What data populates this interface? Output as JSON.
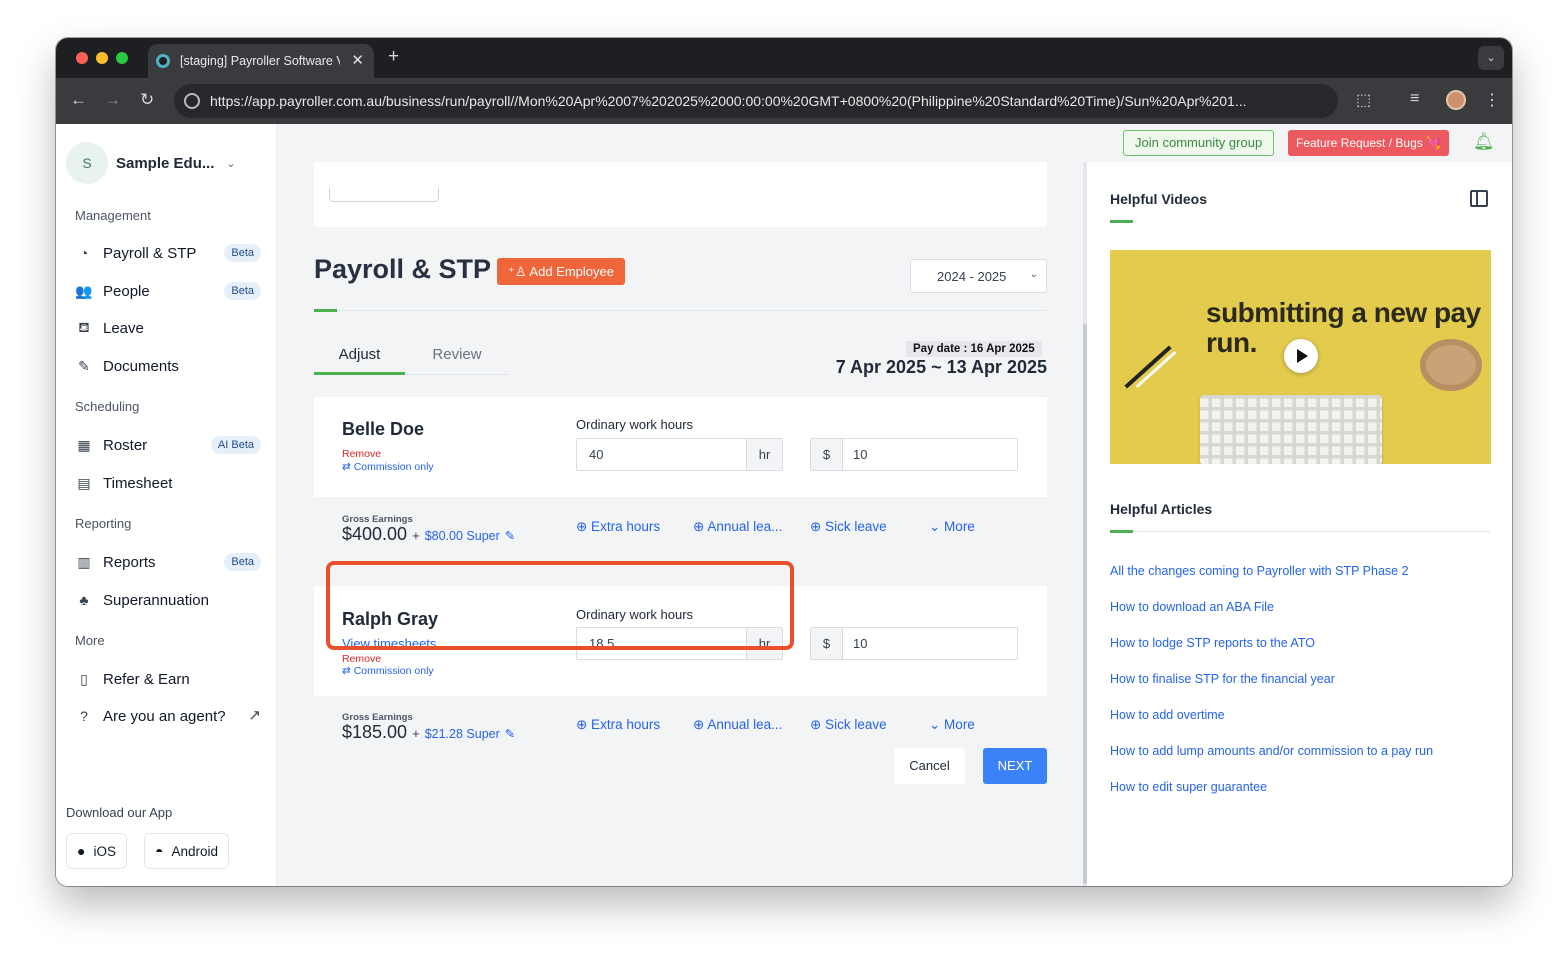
{
  "browser": {
    "tab_title": "[staging] Payroller Software V",
    "url": "https://app.payroller.com.au/business/run/payroll//Mon%20Apr%2007%202025%2000:00:00%20GMT+0800%20(Philippine%20Standard%20Time)/Sun%20Apr%201..."
  },
  "sidebar": {
    "org_initial": "S",
    "org_name": "Sample Edu...",
    "sections": {
      "management": "Management",
      "scheduling": "Scheduling",
      "reporting": "Reporting",
      "more": "More"
    },
    "items": [
      {
        "label": "Payroll & STP",
        "badge": "Beta",
        "icon": "payroll-icon"
      },
      {
        "label": "People",
        "badge": "Beta",
        "icon": "people-icon"
      },
      {
        "label": "Leave",
        "badge": "",
        "icon": "leave-icon"
      },
      {
        "label": "Documents",
        "badge": "",
        "icon": "documents-icon"
      },
      {
        "label": "Roster",
        "badge": "AI Beta",
        "icon": "calendar-icon"
      },
      {
        "label": "Timesheet",
        "badge": "",
        "icon": "timesheet-icon"
      },
      {
        "label": "Reports",
        "badge": "Beta",
        "icon": "reports-icon"
      },
      {
        "label": "Superannuation",
        "badge": "",
        "icon": "piggy-bank-icon"
      },
      {
        "label": "Refer & Earn",
        "badge": "",
        "icon": "refer-icon"
      },
      {
        "label": "Are you an agent?",
        "badge": "",
        "icon": "help-icon"
      }
    ],
    "download_title": "Download our App",
    "ios_label": "iOS",
    "android_label": "Android"
  },
  "topbar": {
    "community": "Join community group",
    "feature": "Feature Request / Bugs 💘"
  },
  "main": {
    "title": "Payroll & STP",
    "add_employee": "Add Employee",
    "year": "2024 - 2025",
    "tabs": [
      "Adjust",
      "Review"
    ],
    "pay_date": "Pay date : 16 Apr 2025",
    "period": "7 Apr 2025 ~ 13 Apr 2025",
    "hours_label": "Ordinary work hours",
    "hours_unit": "hr",
    "currency": "$",
    "gross_label": "Gross Earnings",
    "plus": "+",
    "actions": {
      "extra": "⊕ Extra hours",
      "annual": "⊕ Annual lea...",
      "sick": "⊕ Sick leave",
      "more": "⌄ More"
    },
    "remove_label": "Remove",
    "commission_label": "⇄ Commission only",
    "view_timesheets": "View timesheets",
    "employees": [
      {
        "name": "Belle Doe",
        "hours": "40",
        "rate": "10",
        "gross": "$400.00",
        "super": "$80.00 Super"
      },
      {
        "name": "Ralph Gray",
        "hours": "18.5",
        "rate": "10",
        "gross": "$185.00",
        "super": "$21.28 Super"
      }
    ],
    "cancel": "Cancel",
    "next": "NEXT"
  },
  "right_panel": {
    "videos_title": "Helpful Videos",
    "video_text": "submitting a new pay run.",
    "articles_title": "Helpful Articles",
    "articles": [
      "All the changes coming to Payroller with STP Phase 2",
      "How to download an ABA File",
      "How to lodge STP reports to the ATO",
      "How to finalise STP for the financial year",
      "How to add overtime",
      "How to add lump amounts and/or commission to a pay run",
      "How to edit super guarantee"
    ]
  },
  "colors": {
    "accent_green": "#4caf50",
    "orange": "#f0653a",
    "link_blue": "#2563eb",
    "next_blue": "#3b82f6",
    "highlight": "#ea4e2a"
  }
}
